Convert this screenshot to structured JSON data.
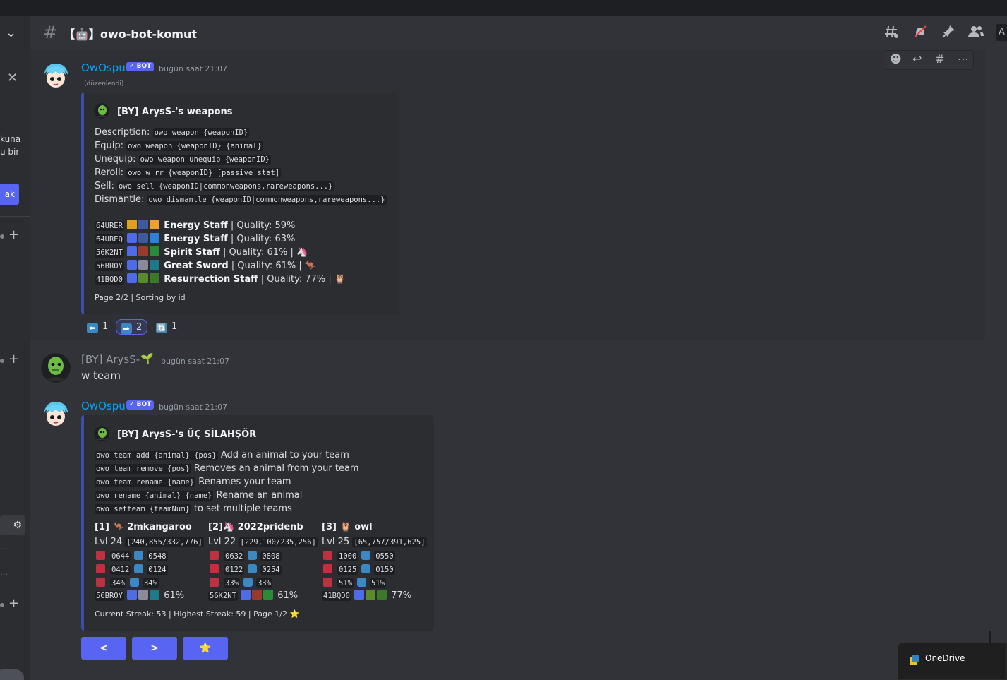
{
  "channel": {
    "name": "【🤖】owo-bot-komut"
  },
  "sidebar": {
    "line1": "kuna",
    "line2": "u bir",
    "button_label": "ak"
  },
  "search_label": "A",
  "messages": [
    {
      "author": "OwOspu",
      "bot_badge": "✓ BOT",
      "timestamp": "bugün saat 21:07",
      "edited": "(düzenlendi)",
      "embed": {
        "title": "[BY] ArysS-'s weapons",
        "commands": [
          {
            "label": "Description:",
            "code": "owo weapon {weaponID}"
          },
          {
            "label": "Equip:",
            "code": "owo weapon {weaponID} {animal}"
          },
          {
            "label": "Unequip:",
            "code": "owo weapon unequip {weaponID}"
          },
          {
            "label": "Reroll:",
            "code": "owo w rr {weaponID} [passive|stat]"
          },
          {
            "label": "Sell:",
            "code": "owo sell {weaponID|commonweapons,rareweapons...}"
          },
          {
            "label": "Dismantle:",
            "code": "owo dismantle {weaponID|commonweapons,rareweapons...}"
          }
        ],
        "weapons": [
          {
            "id": "64URER",
            "name": "Energy Staff",
            "quality": "| Quality: 59%",
            "owner": ""
          },
          {
            "id": "64UREQ",
            "name": "Energy Staff",
            "quality": "| Quality: 63%",
            "owner": ""
          },
          {
            "id": "56K2NT",
            "name": "Spirit Staff",
            "quality": "| Quality: 61% |",
            "owner": "🦄"
          },
          {
            "id": "56BROY",
            "name": "Great Sword",
            "quality": "| Quality: 61% |",
            "owner": "🦘"
          },
          {
            "id": "41BQD0",
            "name": "Resurrection Staff",
            "quality": "| Quality: 77% |",
            "owner": "🦉"
          }
        ],
        "footer": "Page 2/2 | Sorting by id"
      },
      "reactions": [
        {
          "emoji": "⬅",
          "count": "1"
        },
        {
          "emoji": "➡",
          "count": "2"
        },
        {
          "emoji": "🔃",
          "count": "1"
        }
      ]
    },
    {
      "author": "[BY] ArysS-",
      "author_emoji": "🌱",
      "timestamp": "bugün saat 21:07",
      "content": "w team"
    },
    {
      "author": "OwOspu",
      "bot_badge": "✓ BOT",
      "timestamp": "bugün saat 21:07",
      "embed": {
        "title": "[BY] ArysS-'s ÜÇ SİLAHŞÖR",
        "commands": [
          {
            "code": "owo team add {animal} {pos}",
            "text": "Add an animal to your team"
          },
          {
            "code": "owo team remove {pos}",
            "text": "Removes an animal from your team"
          },
          {
            "code": "owo team rename {name}",
            "text": "Renames your team"
          },
          {
            "code": "owo rename {animal} {name}",
            "text": "Rename an animal"
          },
          {
            "code": "owo setteam {teamNum}",
            "text": "to set multiple teams"
          }
        ],
        "team": [
          {
            "slot": "[1]",
            "emoji": "🦘",
            "name": "2mkangaroo",
            "lvl": "Lvl 24",
            "xp": "[240,855/332,776]",
            "hp": "0644",
            "wp": "0548",
            "att": "0412",
            "mag": "0124",
            "pr": "34%",
            "mr": "34%",
            "weapon_id": "56BROY",
            "weapon_q": "61%"
          },
          {
            "slot": "[2]",
            "emoji": "🦄",
            "name": "2022pridenb",
            "lvl": "Lvl 22",
            "xp": "[229,100/235,256]",
            "hp": "0632",
            "wp": "0808",
            "att": "0122",
            "mag": "0254",
            "pr": "33%",
            "mr": "33%",
            "weapon_id": "56K2NT",
            "weapon_q": "61%"
          },
          {
            "slot": "[3]",
            "emoji": "🦉",
            "name": "owl",
            "lvl": "Lvl 25",
            "xp": "[65,757/391,625]",
            "hp": "1000",
            "wp": "0550",
            "att": "0125",
            "mag": "0150",
            "pr": "51%",
            "mr": "51%",
            "weapon_id": "41BQD0",
            "weapon_q": "77%"
          }
        ],
        "footer": "Current Streak: 53 | Highest Streak: 59 | Page 1/2",
        "footer_icon": "⭐"
      },
      "buttons": {
        "prev": "<",
        "next": ">",
        "star": "⭐"
      }
    }
  ],
  "notification": {
    "app": "OneDrive"
  },
  "colors": {
    "bot_name": "#00a8fc",
    "bg": "#313338",
    "embed": "#2b2d31",
    "blurple": "#5865f2"
  }
}
